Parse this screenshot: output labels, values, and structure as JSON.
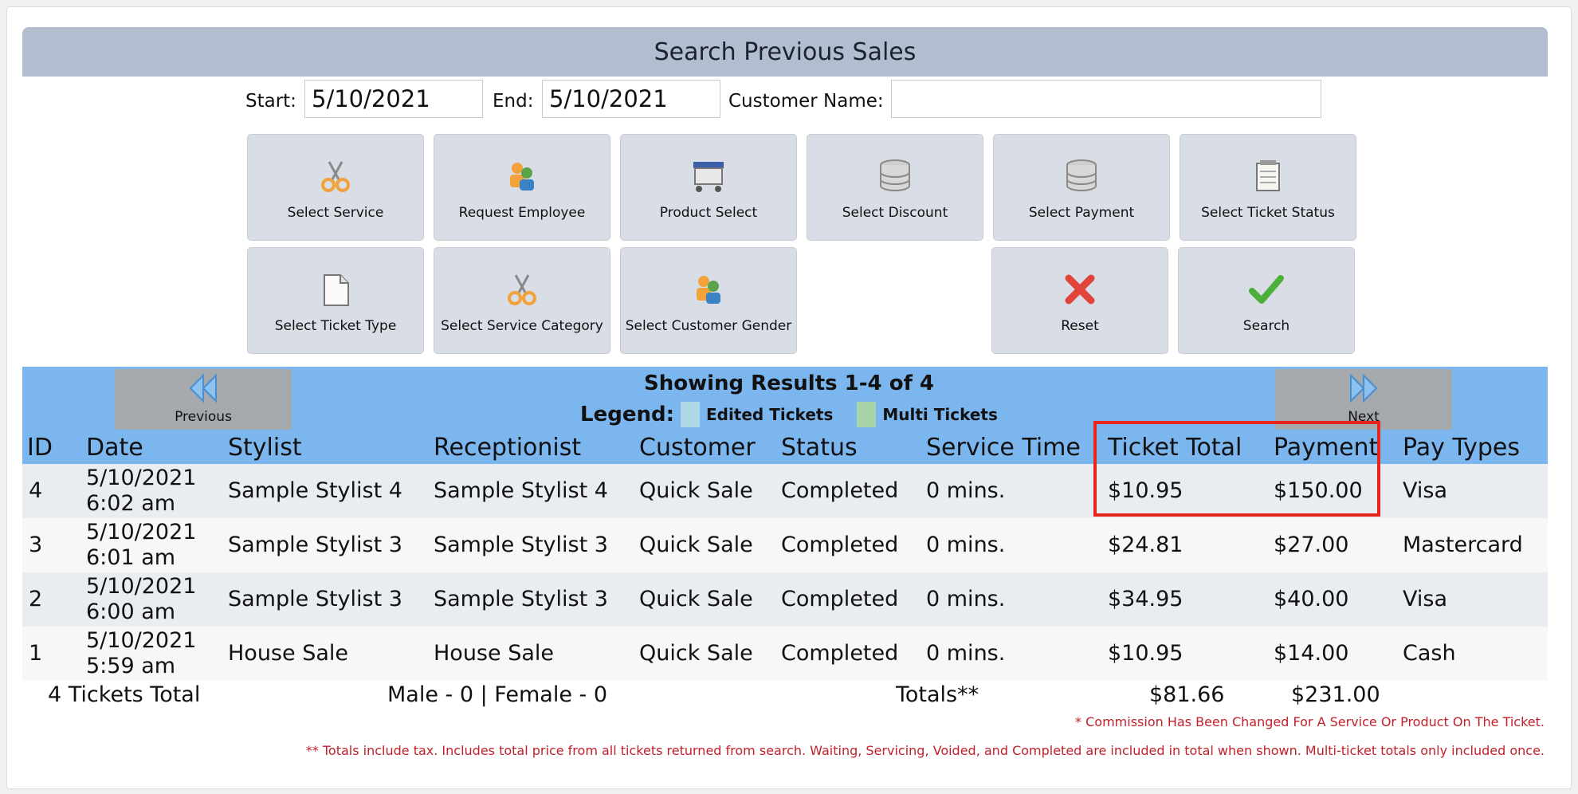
{
  "title": "Search Previous Sales",
  "filters": {
    "start_label": "Start:",
    "start_value": "5/10/2021",
    "end_label": "End:",
    "end_value": "5/10/2021",
    "customer_label": "Customer Name:",
    "customer_value": ""
  },
  "buttons": [
    {
      "label": "Select Service",
      "icon": "scissors-icon"
    },
    {
      "label": "Request Employee",
      "icon": "users-icon"
    },
    {
      "label": "Product Select",
      "icon": "cart-icon"
    },
    {
      "label": "Select Discount",
      "icon": "database-icon"
    },
    {
      "label": "Select Payment",
      "icon": "database-icon"
    },
    {
      "label": "Select Ticket Status",
      "icon": "notepad-icon"
    },
    {
      "label": "Select Ticket Type",
      "icon": "document-icon"
    },
    {
      "label": "Select Service Category",
      "icon": "scissors-icon"
    },
    {
      "label": "Select Customer Gender",
      "icon": "users-icon"
    },
    {
      "label": "Reset",
      "icon": "reset-x-icon"
    },
    {
      "label": "Search",
      "icon": "checkmark-icon"
    }
  ],
  "nav": {
    "previous": "Previous",
    "next": "Next"
  },
  "results": {
    "showing": "Showing Results 1-4 of 4",
    "legend_label": "Legend:",
    "legend_items": [
      {
        "label": "Edited Tickets",
        "color": "#add8e6"
      },
      {
        "label": "Multi Tickets",
        "color": "#a9d3a9"
      }
    ]
  },
  "table": {
    "columns": [
      "ID",
      "Date",
      "Stylist",
      "Receptionist",
      "Customer",
      "Status",
      "Service Time",
      "Ticket Total",
      "Payment",
      "Pay Types"
    ],
    "rows": [
      {
        "id": "4",
        "date": "5/10/2021",
        "time": "6:02 am",
        "stylist": "Sample Stylist 4",
        "receptionist": "Sample Stylist 4",
        "customer": "Quick Sale",
        "status": "Completed",
        "service_time": "0 mins.",
        "ticket_total": "$10.95",
        "payment": "$150.00",
        "pay_types": "Visa"
      },
      {
        "id": "3",
        "date": "5/10/2021",
        "time": "6:01 am",
        "stylist": "Sample Stylist 3",
        "receptionist": "Sample Stylist 3",
        "customer": "Quick Sale",
        "status": "Completed",
        "service_time": "0 mins.",
        "ticket_total": "$24.81",
        "payment": "$27.00",
        "pay_types": "Mastercard"
      },
      {
        "id": "2",
        "date": "5/10/2021",
        "time": "6:00 am",
        "stylist": "Sample Stylist 3",
        "receptionist": "Sample Stylist 3",
        "customer": "Quick Sale",
        "status": "Completed",
        "service_time": "0 mins.",
        "ticket_total": "$34.95",
        "payment": "$40.00",
        "pay_types": "Visa"
      },
      {
        "id": "1",
        "date": "5/10/2021",
        "time": "5:59 am",
        "stylist": "House Sale",
        "receptionist": "House Sale",
        "customer": "Quick Sale",
        "status": "Completed",
        "service_time": "0 mins.",
        "ticket_total": "$10.95",
        "payment": "$14.00",
        "pay_types": "Cash"
      }
    ]
  },
  "totals": {
    "tickets": "4 Tickets Total",
    "gender": "Male - 0 | Female - 0",
    "label": "Totals**",
    "ticket_total": "$81.66",
    "payment": "$231.00"
  },
  "notes": {
    "commission": "* Commission Has Been Changed For A Service Or Product On The Ticket.",
    "totals": "** Totals include tax. Includes total price from all tickets returned from search. Waiting, Servicing, Voided, and Completed are included in total when shown. Multi-ticket totals only included once."
  },
  "colors": {
    "title_bar": "#b3bdd0",
    "button_bg": "#d9dde5",
    "results_band": "#7bb6ee",
    "row_alt": "#e9ecf1",
    "highlight": "#e8251b",
    "note_text": "#c2202a"
  }
}
